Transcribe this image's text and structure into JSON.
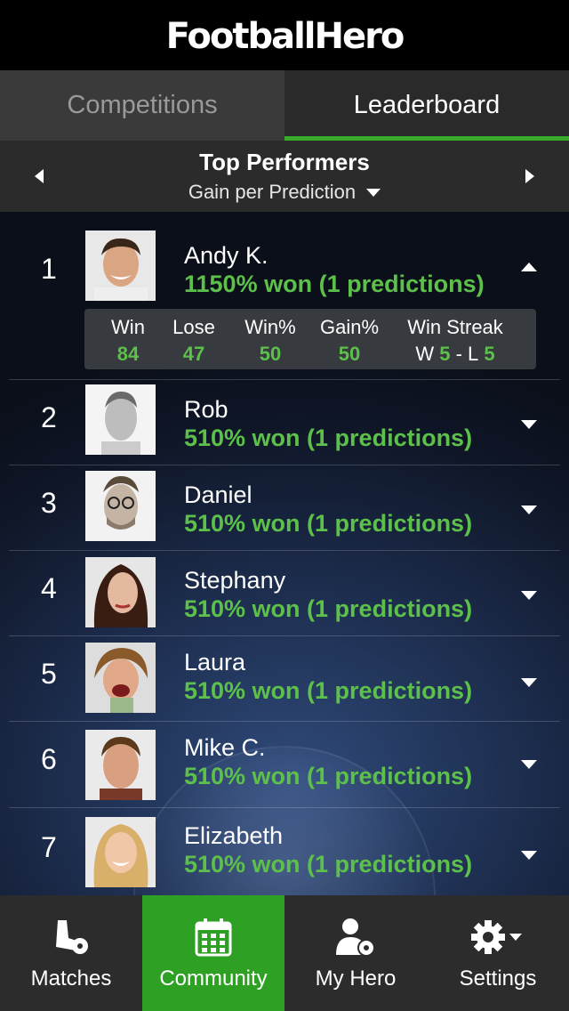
{
  "app": {
    "logo": "FootballHero"
  },
  "tabs": [
    {
      "label": "Competitions",
      "active": false
    },
    {
      "label": "Leaderboard",
      "active": true
    }
  ],
  "subheader": {
    "title": "Top Performers",
    "subtitle": "Gain per Prediction"
  },
  "leaderboard": [
    {
      "rank": "1",
      "name": "Andy K.",
      "stat": "1150% won (1 predictions)",
      "expanded": true
    },
    {
      "rank": "2",
      "name": "Rob",
      "stat": "510% won (1 predictions)",
      "expanded": false
    },
    {
      "rank": "3",
      "name": "Daniel",
      "stat": "510% won (1 predictions)",
      "expanded": false
    },
    {
      "rank": "4",
      "name": "Stephany",
      "stat": "510% won (1 predictions)",
      "expanded": false
    },
    {
      "rank": "5",
      "name": "Laura",
      "stat": "510% won (1 predictions)",
      "expanded": false
    },
    {
      "rank": "6",
      "name": "Mike C.",
      "stat": "510% won (1 predictions)",
      "expanded": false
    },
    {
      "rank": "7",
      "name": "Elizabeth",
      "stat": "510% won (1 predictions)",
      "expanded": false
    }
  ],
  "details": {
    "win_label": "Win",
    "win_value": "84",
    "lose_label": "Lose",
    "lose_value": "47",
    "winpct_label": "Win%",
    "winpct_value": "50",
    "gainpct_label": "Gain%",
    "gainpct_value": "50",
    "streak_label": "Win Streak",
    "streak_w_prefix": "W",
    "streak_w": "5",
    "streak_sep": "- L",
    "streak_l": "5"
  },
  "tabbar": [
    {
      "label": "Matches",
      "icon": "boot-ball-icon",
      "active": false
    },
    {
      "label": "Community",
      "icon": "calendar-icon",
      "active": true
    },
    {
      "label": "My Hero",
      "icon": "person-ball-icon",
      "active": false
    },
    {
      "label": "Settings",
      "icon": "gear-icon",
      "active": false
    }
  ],
  "colors": {
    "accent": "#3aaa2a",
    "stat_green": "#5cc04a",
    "tabbar_active": "#2ea023"
  }
}
